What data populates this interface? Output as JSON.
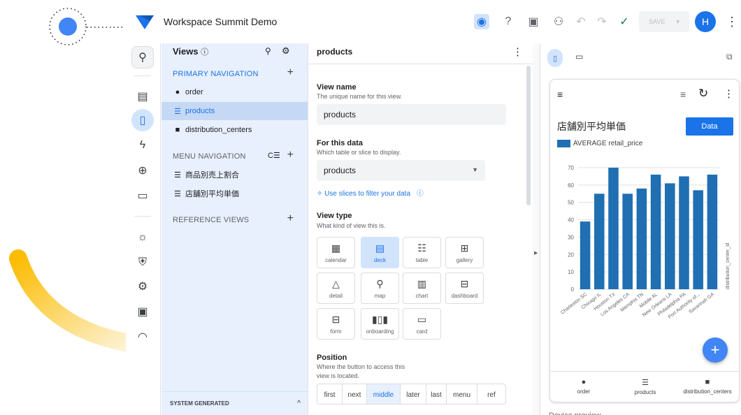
{
  "app": {
    "title": "Workspace Summit Demo",
    "avatar_initial": "H",
    "save_label": "SAVE",
    "brand_color": "#1a73e8"
  },
  "views_panel": {
    "title": "Views",
    "primary_header": "PRIMARY NAVIGATION",
    "primary_items": [
      {
        "label": "order",
        "icon": "check-circle-icon"
      },
      {
        "label": "products",
        "icon": "list-icon",
        "selected": true
      },
      {
        "label": "distribution_centers",
        "icon": "truck-icon"
      }
    ],
    "menu_header": "MENU NAVIGATION",
    "menu_items": [
      {
        "label": "商品別売上割合",
        "icon": "list-icon"
      },
      {
        "label": "店舗別平均単価",
        "icon": "list-icon"
      }
    ],
    "reference_header": "REFERENCE VIEWS",
    "system_generated": "SYSTEM GENERATED"
  },
  "editor": {
    "title": "products",
    "view_name_label": "View name",
    "view_name_help": "The unique name for this view.",
    "view_name_value": "products",
    "for_data_label": "For this data",
    "for_data_help": "Which table or slice to display.",
    "for_data_value": "products",
    "slices_link": "Use slices to filter your data",
    "view_type_label": "View type",
    "view_type_help": "What kind of view this is.",
    "view_types": [
      "calendar",
      "deck",
      "table",
      "gallery",
      "detail",
      "map",
      "chart",
      "dashboard",
      "form",
      "onboarding",
      "card"
    ],
    "selected_view_type": "deck",
    "position_label": "Position",
    "position_help_1": "Where the button to access this",
    "position_help_2": "view is located.",
    "positions": [
      "first",
      "next",
      "middle",
      "later",
      "last",
      "menu",
      "ref"
    ],
    "selected_position": "middle"
  },
  "preview": {
    "chart_title": "店舗別平均単価",
    "data_button": "Data",
    "bottom_nav": [
      "order",
      "products",
      "distribution_centers"
    ],
    "footer_partial": "Device preview"
  },
  "chart_data": {
    "type": "bar",
    "categories": [
      "Charleston SC",
      "Chicago IL",
      "Houston TX",
      "Los Angeles CA",
      "Memphis TN",
      "Mobile AL",
      "New Orleans LA",
      "Philadelphia PA",
      "Port Authority of...",
      "Savannah GA"
    ],
    "series": [
      {
        "name": "AVERAGE retail_price",
        "values": [
          39,
          55,
          70,
          55,
          58,
          66,
          61,
          65,
          57,
          66
        ]
      }
    ],
    "ylim": [
      0,
      70
    ],
    "yticks": [
      0,
      10,
      20,
      30,
      40,
      50,
      60,
      70
    ],
    "xlabel": "",
    "ylabel": "distribution_center_id",
    "bar_color": "#1f6fb2",
    "grid": true,
    "legend": "top-left"
  }
}
